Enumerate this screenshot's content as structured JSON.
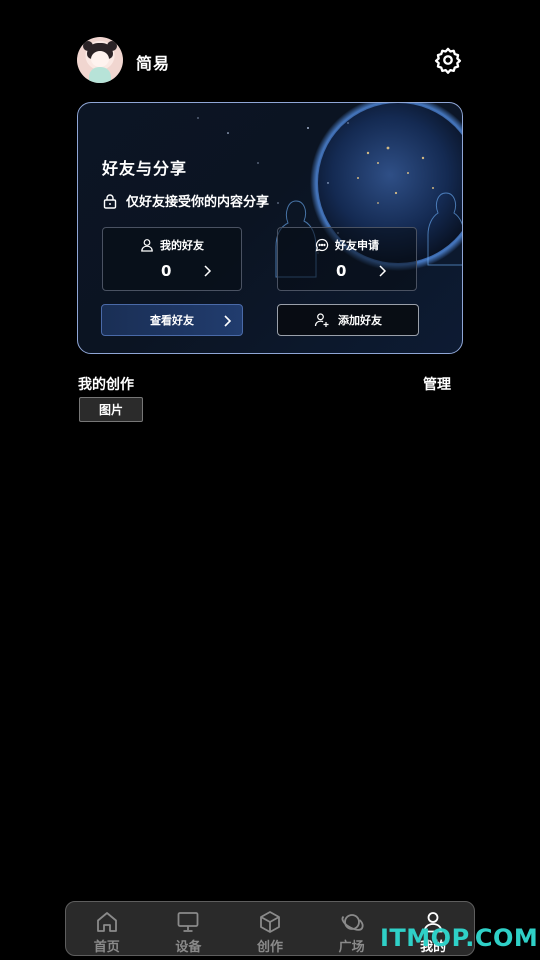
{
  "profile": {
    "name": "简易",
    "avatar_icon": "avatar-girl-icon"
  },
  "settings_icon": "gear-icon",
  "friends_card": {
    "title": "好友与分享",
    "privacy_text": "仅好友接受你的内容分享",
    "my_friends": {
      "label": "我的好友",
      "count": "0"
    },
    "friend_requests": {
      "label": "好友申请",
      "count": "0"
    },
    "view_friends_label": "查看好友",
    "add_friend_label": "添加好友"
  },
  "creations": {
    "title": "我的创作",
    "manage_label": "管理",
    "tags": [
      "图片"
    ]
  },
  "tabbar": {
    "items": [
      {
        "label": "首页",
        "icon": "home-icon"
      },
      {
        "label": "设备",
        "icon": "monitor-icon"
      },
      {
        "label": "创作",
        "icon": "cube-icon"
      },
      {
        "label": "广场",
        "icon": "planet-icon"
      },
      {
        "label": "我的",
        "icon": "user-icon"
      }
    ],
    "active_index": 4
  },
  "watermark": "ITMOP.COM",
  "colors": {
    "background": "#000000",
    "card_border": "#8fa6d6",
    "primary_button": "#213c6e",
    "watermark": "#2fd0c7"
  }
}
